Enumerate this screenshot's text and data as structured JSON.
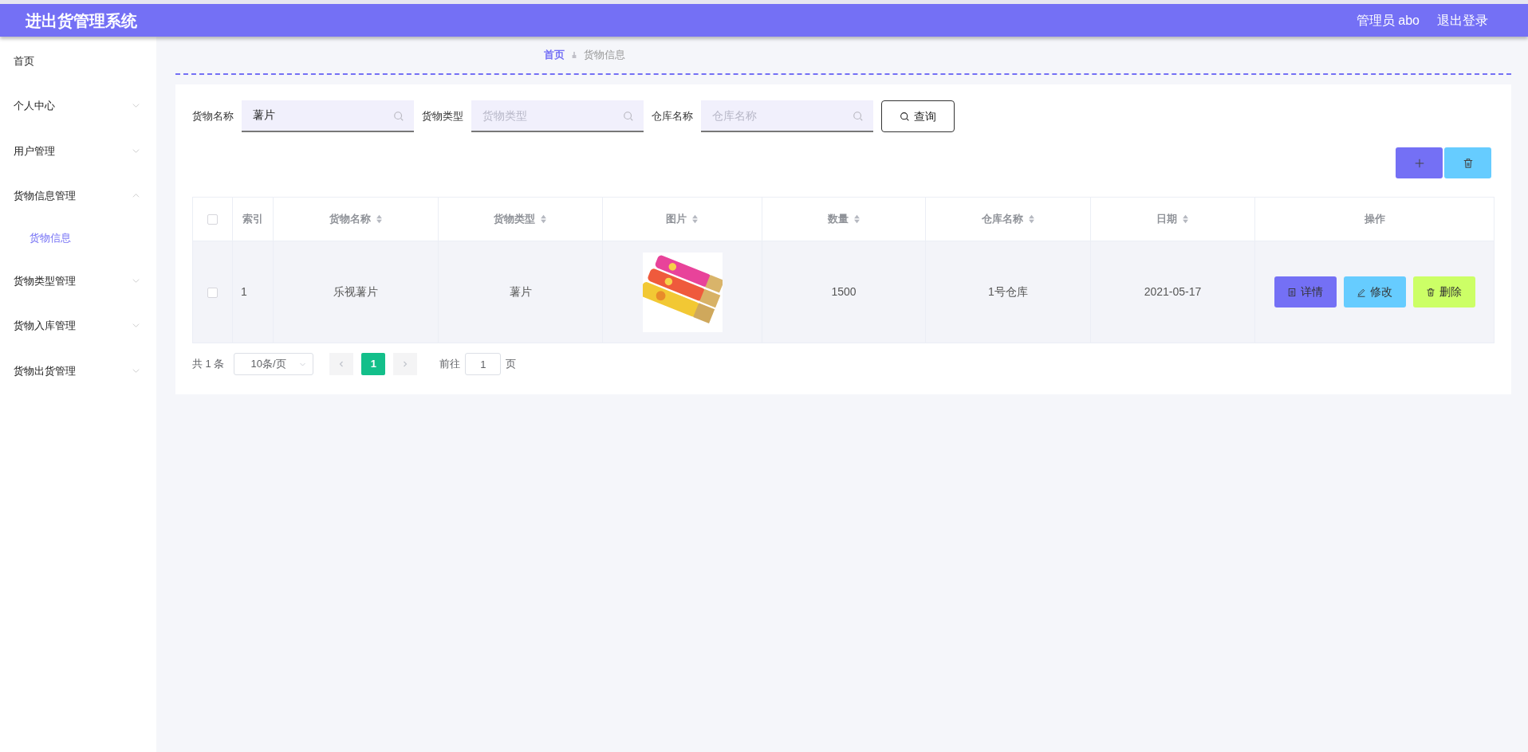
{
  "header": {
    "title": "进出货管理系统",
    "user": "管理员 abo",
    "logout": "退出登录"
  },
  "sidebar": {
    "items": [
      {
        "label": "首页",
        "kind": "link"
      },
      {
        "label": "个人中心",
        "kind": "submenu",
        "expanded": false
      },
      {
        "label": "用户管理",
        "kind": "submenu",
        "expanded": false
      },
      {
        "label": "货物信息管理",
        "kind": "submenu",
        "expanded": true,
        "children": [
          {
            "label": "货物信息",
            "selected": true
          }
        ]
      },
      {
        "label": "货物类型管理",
        "kind": "submenu",
        "expanded": false
      },
      {
        "label": "货物入库管理",
        "kind": "submenu",
        "expanded": false
      },
      {
        "label": "货物出货管理",
        "kind": "submenu",
        "expanded": false
      }
    ]
  },
  "breadcrumb": [
    {
      "label": "首页",
      "current": false
    },
    {
      "label": "货物信息",
      "current": true
    }
  ],
  "search": {
    "fields": [
      {
        "label": "货物名称",
        "value": "薯片"
      },
      {
        "label": "货物类型",
        "placeholder": "货物类型"
      },
      {
        "label": "仓库名称",
        "placeholder": "仓库名称"
      }
    ],
    "button": "查询"
  },
  "toolbar": [
    {
      "kind": "add"
    },
    {
      "kind": "delete"
    }
  ],
  "table": {
    "columns": [
      {
        "kind": "checkbox",
        "checked": false
      },
      {
        "label": "索引",
        "sortable": false
      },
      {
        "label": "货物名称",
        "sortable": true
      },
      {
        "label": "货物类型",
        "sortable": true
      },
      {
        "label": "图片",
        "sortable": true
      },
      {
        "label": "数量",
        "sortable": true
      },
      {
        "label": "仓库名称",
        "sortable": true
      },
      {
        "label": "日期",
        "sortable": true
      },
      {
        "label": "操作",
        "sortable": false
      }
    ],
    "rows": [
      {
        "cells": [
          {
            "kind": "checkbox",
            "checked": false
          },
          {
            "kind": "text",
            "text": "1"
          },
          {
            "kind": "text",
            "text": "乐视薯片"
          },
          {
            "kind": "text",
            "text": "薯片"
          },
          {
            "kind": "picture"
          },
          {
            "kind": "text",
            "text": "1500"
          },
          {
            "kind": "text",
            "text": "1号仓库"
          },
          {
            "kind": "text",
            "text": "2021-05-17"
          },
          {
            "kind": "actions",
            "actions": [
              {
                "kind": "detail",
                "label": "详情"
              },
              {
                "kind": "edit",
                "label": "修改"
              },
              {
                "kind": "delete",
                "label": "删除"
              }
            ]
          }
        ]
      }
    ]
  },
  "pagination": {
    "total": "共 1 条",
    "page_size": "10条/页",
    "pages": [
      {
        "label": "1",
        "selected": true
      }
    ],
    "goto_label": "前往",
    "goto_value": "1",
    "goto_suffix": "页"
  }
}
